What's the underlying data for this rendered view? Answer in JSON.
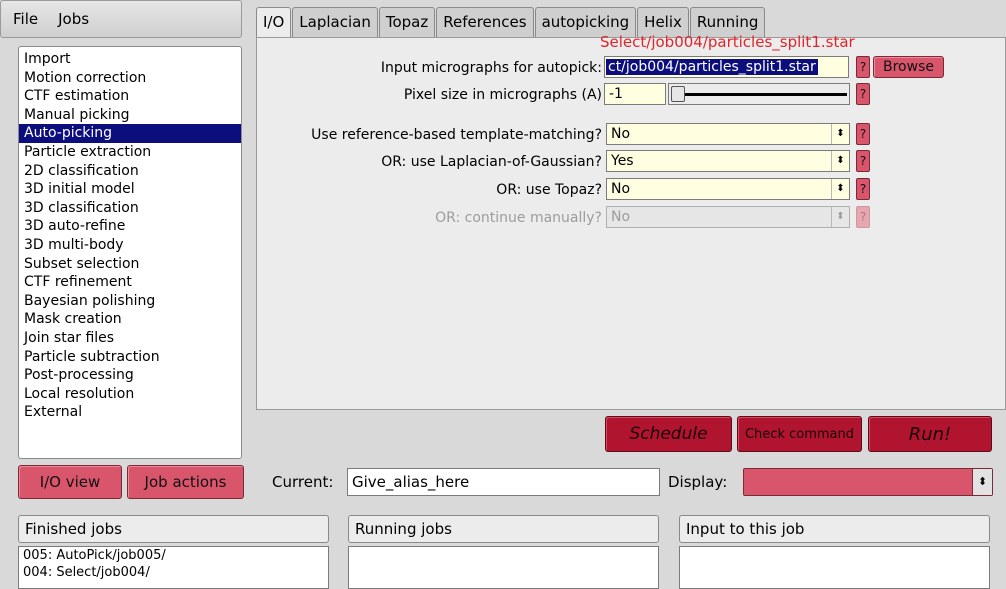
{
  "menu": {
    "file": "File",
    "jobs": "Jobs"
  },
  "job_types": [
    "Import",
    "Motion correction",
    "CTF estimation",
    "Manual picking",
    "Auto-picking",
    "Particle extraction",
    "2D classification",
    "3D initial model",
    "3D classification",
    "3D auto-refine",
    "3D multi-body",
    "Subset selection",
    "CTF refinement",
    "Bayesian polishing",
    "Mask creation",
    "Join star files",
    "Particle subtraction",
    "Post-processing",
    "Local resolution",
    "External"
  ],
  "selected_job_index": 4,
  "view_buttons": {
    "io_view": "I/O view",
    "job_actions": "Job actions"
  },
  "tabs": [
    "I/O",
    "Laplacian",
    "Topaz",
    "References",
    "autopicking",
    "Helix",
    "Running"
  ],
  "active_tab_index": 0,
  "tooltip": "Select/job004/particles_split1.star",
  "form": {
    "input_label": "Input micrographs for autopick:",
    "input_value": "ct/job004/particles_split1.star",
    "browse": "Browse",
    "pixel_label": "Pixel size in micrographs (A)",
    "pixel_value": "-1",
    "q": "?",
    "ref_label": "Use reference-based template-matching?",
    "ref_value": "No",
    "log_label": "OR: use Laplacian-of-Gaussian?",
    "log_value": "Yes",
    "topaz_label": "OR: use Topaz?",
    "topaz_value": "No",
    "manual_label": "OR: continue manually?",
    "manual_value": "No"
  },
  "actions": {
    "schedule": "Schedule",
    "check": "Check command",
    "run": "Run!"
  },
  "current_label": "Current:",
  "current_value": "Give_alias_here",
  "display_label": "Display:",
  "spin_glyph": "▴▾",
  "select_glyph": "⬍",
  "panels": {
    "finished": "Finished jobs",
    "running": "Running jobs",
    "input": "Input to this job"
  },
  "finished_jobs": [
    "005: AutoPick/job005/",
    "004: Select/job004/"
  ]
}
